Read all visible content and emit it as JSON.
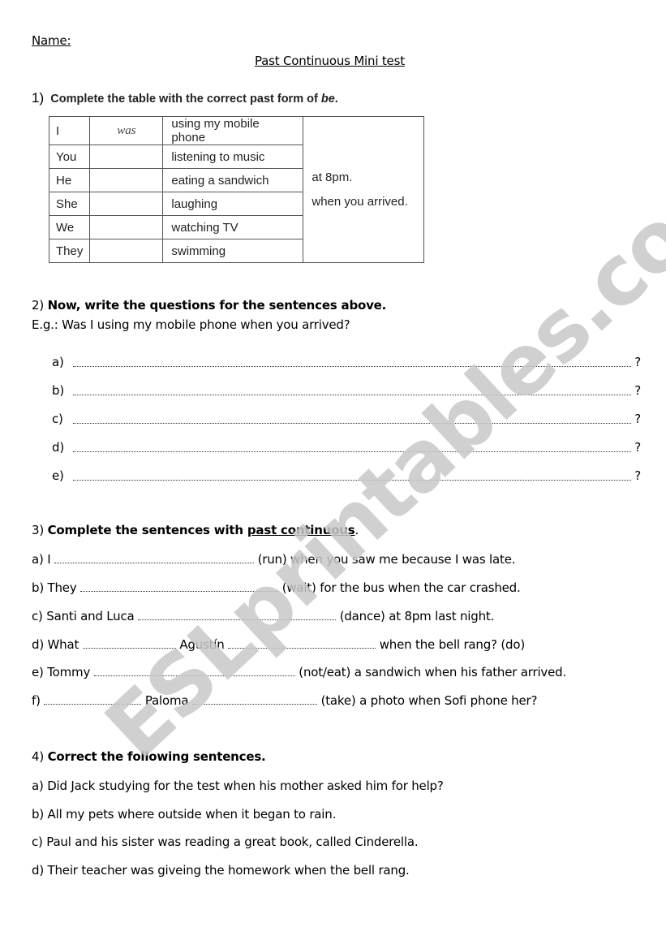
{
  "header": {
    "name_label": "Name:",
    "title": "Past Continuous Mini test"
  },
  "section1": {
    "number": "1)",
    "instruction": "Complete the table with the correct past form of ",
    "instruction_italic": "be",
    "instruction_end": ".",
    "table": {
      "rows": [
        {
          "subject": "I",
          "be": "was",
          "activity": "using my mobile phone"
        },
        {
          "subject": "You",
          "be": "",
          "activity": "listening to music"
        },
        {
          "subject": "He",
          "be": "",
          "activity": "eating a sandwich"
        },
        {
          "subject": "She",
          "be": "",
          "activity": "laughing"
        },
        {
          "subject": "We",
          "be": "",
          "activity": "watching TV"
        },
        {
          "subject": "They",
          "be": "",
          "activity": "swimming"
        }
      ],
      "time_options": [
        "at 8pm.",
        "when you arrived."
      ]
    }
  },
  "section2": {
    "number": "2)",
    "instruction": "Now, write the questions for the sentences above.",
    "example": "E.g.: Was I using my mobile phone when you arrived?",
    "items": [
      {
        "label": "a)",
        "end": "?"
      },
      {
        "label": "b)",
        "end": "?"
      },
      {
        "label": "c)",
        "end": "?"
      },
      {
        "label": "d)",
        "end": "?"
      },
      {
        "label": "e)",
        "end": "?"
      }
    ]
  },
  "section3": {
    "number": "3)",
    "instruction_start": "Complete the sentences with ",
    "instruction_underlined": "past continuous",
    "instruction_end": ".",
    "items": [
      {
        "label": "a) I",
        "mid": "",
        "after": "(run) when you saw me because I was late."
      },
      {
        "label": "b) They",
        "mid": "",
        "after": "(wait) for the bus when the car crashed."
      },
      {
        "label": "c) Santi and Luca",
        "mid": "",
        "after": "(dance) at 8pm last night."
      },
      {
        "label": "d) What",
        "mid": "Agustín",
        "after": "when the bell rang? (do)"
      },
      {
        "label": "e) Tommy",
        "mid": "",
        "after": "(not/eat) a sandwich when his father arrived."
      },
      {
        "label": "f)",
        "mid": "Paloma",
        "after": "(take) a photo when Sofi phone her?"
      }
    ]
  },
  "section4": {
    "number": "4)",
    "instruction": "Correct the following sentences.",
    "items": [
      "a) Did Jack studying for the test when his mother asked him for help?",
      "b) All my pets where outside when it began to rain.",
      "c) Paul and his sister was reading a great book, called Cinderella.",
      "d) Their teacher was giveing the homework when the bell rang."
    ]
  },
  "watermark": "ESLprintables.com"
}
